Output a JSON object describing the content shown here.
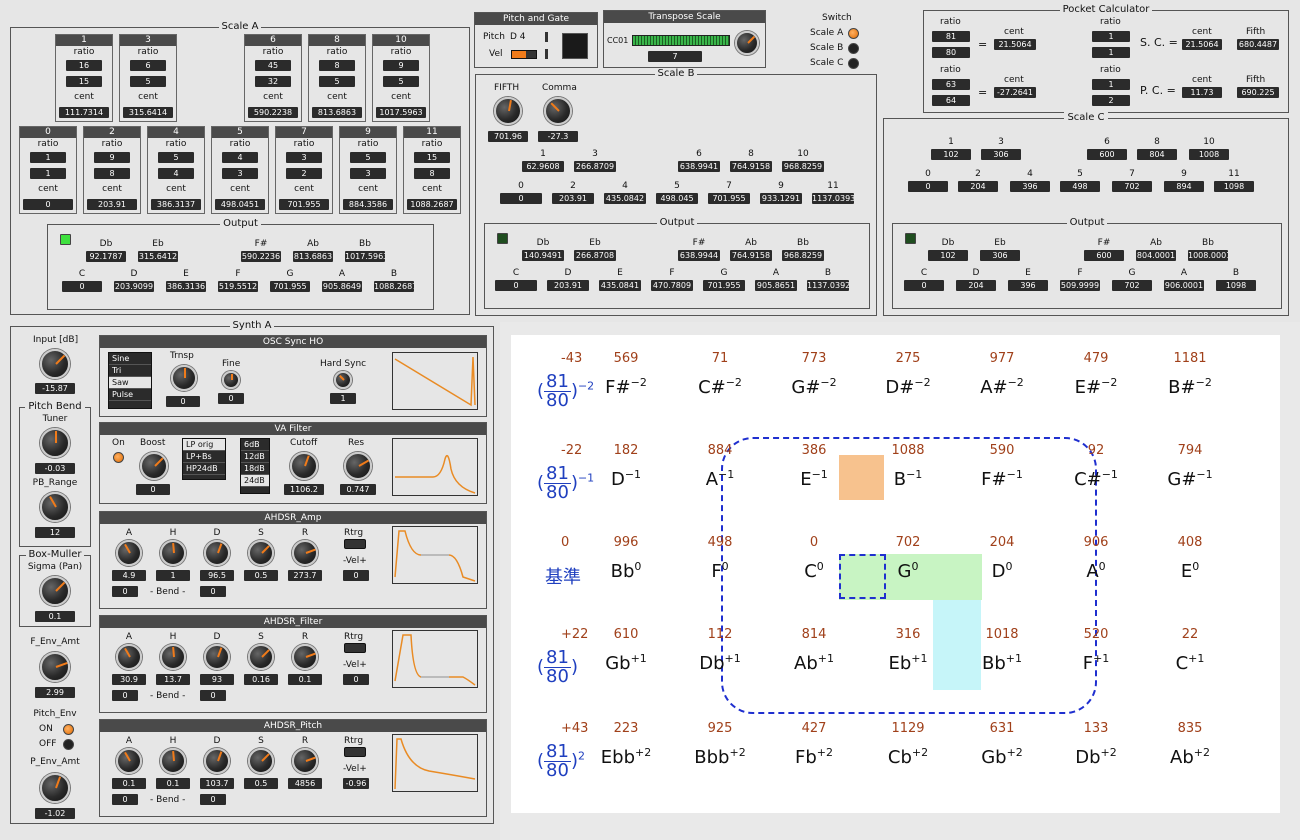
{
  "scaleA": {
    "title": "Scale A",
    "top": [
      {
        "n": "1",
        "r1": "16",
        "r2": "15",
        "c": "111.7314"
      },
      {
        "n": "3",
        "r1": "6",
        "r2": "5",
        "c": "315.6414"
      },
      {
        "n": "6",
        "r1": "45",
        "r2": "32",
        "c": "590.2238"
      },
      {
        "n": "8",
        "r1": "8",
        "r2": "5",
        "c": "813.6863"
      },
      {
        "n": "10",
        "r1": "9",
        "r2": "5",
        "c": "1017.5963"
      }
    ],
    "bottom": [
      {
        "n": "0",
        "r1": "1",
        "r2": "1",
        "c": "0"
      },
      {
        "n": "2",
        "r1": "9",
        "r2": "8",
        "c": "203.91"
      },
      {
        "n": "4",
        "r1": "5",
        "r2": "4",
        "c": "386.3137"
      },
      {
        "n": "5",
        "r1": "4",
        "r2": "3",
        "c": "498.0451"
      },
      {
        "n": "7",
        "r1": "3",
        "r2": "2",
        "c": "701.955"
      },
      {
        "n": "9",
        "r1": "5",
        "r2": "3",
        "c": "884.3586"
      },
      {
        "n": "11",
        "r1": "15",
        "r2": "8",
        "c": "1088.2687"
      }
    ],
    "ratio": "ratio",
    "cent": "cent",
    "output": {
      "title": "Output",
      "sharps": [
        {
          "k": "Db",
          "v": "92.1787"
        },
        {
          "k": "Eb",
          "v": "315.6412"
        },
        {
          "k": "F#",
          "v": "590.2236"
        },
        {
          "k": "Ab",
          "v": "813.6863"
        },
        {
          "k": "Bb",
          "v": "1017.5963"
        }
      ],
      "naturals": [
        {
          "k": "C",
          "v": "0"
        },
        {
          "k": "D",
          "v": "203.9099"
        },
        {
          "k": "E",
          "v": "386.3136"
        },
        {
          "k": "F",
          "v": "519.5512"
        },
        {
          "k": "G",
          "v": "701.955"
        },
        {
          "k": "A",
          "v": "905.8649"
        },
        {
          "k": "B",
          "v": "1088.2687"
        }
      ]
    }
  },
  "pitchGate": {
    "title": "Pitch and Gate",
    "pitch_label": "Pitch",
    "pitch_value": "D  4",
    "vel_label": "Vel"
  },
  "transpose": {
    "title": "Transpose Scale",
    "cc": "CC01",
    "value": "7"
  },
  "switch": {
    "title": "Switch",
    "items": [
      "Scale A",
      "Scale B",
      "Scale C"
    ]
  },
  "pocket": {
    "title": "Pocket Calculator",
    "ratio": "ratio",
    "cent": "cent",
    "fifth": "Fifth",
    "r1": {
      "a": "81",
      "b": "80",
      "cent": "21.5064"
    },
    "r2": {
      "a": "63",
      "b": "64",
      "cent": "-27.2641"
    },
    "sc": {
      "label": "S. C. =",
      "a": "1",
      "b": "1",
      "cent": "21.5064",
      "fifth": "680.4487"
    },
    "pc": {
      "label": "P. C. =",
      "a": "1",
      "b": "2",
      "cent": "11.73",
      "fifth": "690.225"
    },
    "eq": "="
  },
  "scaleB": {
    "title": "Scale B",
    "fifth_label": "FIFTH",
    "fifth_value": "701.96",
    "comma_label": "Comma",
    "comma_value": "-27.3",
    "top": [
      {
        "n": "1",
        "c": "62.9608"
      },
      {
        "n": "3",
        "c": "266.8709"
      },
      {
        "n": "6",
        "c": "638.9941"
      },
      {
        "n": "8",
        "c": "764.9158"
      },
      {
        "n": "10",
        "c": "968.8259"
      }
    ],
    "bottom": [
      {
        "n": "0",
        "c": "0"
      },
      {
        "n": "2",
        "c": "203.91"
      },
      {
        "n": "4",
        "c": "435.0842"
      },
      {
        "n": "5",
        "c": "498.045"
      },
      {
        "n": "7",
        "c": "701.955"
      },
      {
        "n": "9",
        "c": "933.1291"
      },
      {
        "n": "11",
        "c": "1137.0393"
      }
    ],
    "output": {
      "title": "Output",
      "sharps": [
        {
          "k": "Db",
          "v": "140.9491"
        },
        {
          "k": "Eb",
          "v": "266.8708"
        },
        {
          "k": "F#",
          "v": "638.9944"
        },
        {
          "k": "Ab",
          "v": "764.9158"
        },
        {
          "k": "Bb",
          "v": "968.8259"
        }
      ],
      "naturals": [
        {
          "k": "C",
          "v": "0"
        },
        {
          "k": "D",
          "v": "203.91"
        },
        {
          "k": "E",
          "v": "435.0841"
        },
        {
          "k": "F",
          "v": "470.7809"
        },
        {
          "k": "G",
          "v": "701.955"
        },
        {
          "k": "A",
          "v": "905.8651"
        },
        {
          "k": "B",
          "v": "1137.0392"
        }
      ]
    }
  },
  "scaleC": {
    "title": "Scale C",
    "top": [
      {
        "n": "1",
        "c": "102"
      },
      {
        "n": "3",
        "c": "306"
      },
      {
        "n": "6",
        "c": "600"
      },
      {
        "n": "8",
        "c": "804"
      },
      {
        "n": "10",
        "c": "1008"
      }
    ],
    "bottom": [
      {
        "n": "0",
        "c": "0"
      },
      {
        "n": "2",
        "c": "204"
      },
      {
        "n": "4",
        "c": "396"
      },
      {
        "n": "5",
        "c": "498"
      },
      {
        "n": "7",
        "c": "702"
      },
      {
        "n": "9",
        "c": "894"
      },
      {
        "n": "11",
        "c": "1098"
      }
    ],
    "output": {
      "title": "Output",
      "sharps": [
        {
          "k": "Db",
          "v": "102"
        },
        {
          "k": "Eb",
          "v": "306"
        },
        {
          "k": "F#",
          "v": "600"
        },
        {
          "k": "Ab",
          "v": "804.0001"
        },
        {
          "k": "Bb",
          "v": "1008.0001"
        }
      ],
      "naturals": [
        {
          "k": "C",
          "v": "0"
        },
        {
          "k": "D",
          "v": "204"
        },
        {
          "k": "E",
          "v": "396"
        },
        {
          "k": "F",
          "v": "509.9999"
        },
        {
          "k": "G",
          "v": "702"
        },
        {
          "k": "A",
          "v": "906.0001"
        },
        {
          "k": "B",
          "v": "1098"
        }
      ]
    }
  },
  "synth": {
    "title": "Synth A",
    "input_label": "Input [dB]",
    "input_value": "-15.87",
    "pitchbend": {
      "title": "Pitch Bend",
      "tuner": "Tuner",
      "tuner_value": "-0.03",
      "pbrange": "PB_Range",
      "pbrange_value": "12"
    },
    "boxmuller": {
      "title": "Box-Muller",
      "sigma": "Sigma (Pan)",
      "sigma_value": "0.1"
    },
    "fenv": {
      "label": "F_Env_Amt",
      "value": "2.99"
    },
    "pitchenv": {
      "label": "Pitch_Env",
      "on": "ON",
      "off": "OFF"
    },
    "penv": {
      "label": "P_Env_Amt",
      "value": "-1.02"
    },
    "osc": {
      "title": "OSC Sync HO",
      "waves": [
        "Sine",
        "Tri",
        "Saw",
        "Pulse"
      ],
      "trnsp": "Trnsp",
      "trnsp_value": "0",
      "fine": "Fine",
      "fine_value": "0",
      "hardsync": "Hard Sync",
      "hardsync_value": "1"
    },
    "filter": {
      "title": "VA Filter",
      "on": "On",
      "boost": "Boost",
      "boost_value": "0",
      "types": [
        "LP orig",
        "LP+Bs",
        "HP24dB"
      ],
      "slopes": [
        "6dB",
        "12dB",
        "18dB",
        "24dB"
      ],
      "cutoff": "Cutoff",
      "cutoff_value": "1106.2",
      "res": "Res",
      "res_value": "0.747"
    },
    "envs": [
      {
        "title": "AHDSR_Amp",
        "vals": [
          "4.9",
          "1",
          "96.5",
          "0.5",
          "273.7"
        ],
        "bend": [
          "0",
          "0"
        ],
        "vel": "0"
      },
      {
        "title": "AHDSR_Filter",
        "vals": [
          "30.9",
          "13.7",
          "93",
          "0.16",
          "0.1"
        ],
        "bend": [
          "0",
          "0"
        ],
        "vel": "0"
      },
      {
        "title": "AHDSR_Pitch",
        "vals": [
          "0.1",
          "0.1",
          "103.7",
          "0.5",
          "4856"
        ],
        "bend": [
          "0",
          "0"
        ],
        "vel": "-0.96"
      }
    ],
    "env_labels": [
      "A",
      "H",
      "D",
      "S",
      "R"
    ],
    "rtrg": "Rtrg",
    "vel_label": "-Vel+",
    "bend_label": "- Bend -"
  },
  "table": {
    "rowlabels": [
      {
        "v": "-43",
        "a": "81",
        "b": "80",
        "exp": "−2"
      },
      {
        "v": "-22",
        "a": "81",
        "b": "80",
        "exp": "−1"
      },
      {
        "v": "0",
        "text": "基準"
      },
      {
        "v": "+22",
        "a": "81",
        "b": "80",
        "exp": ""
      },
      {
        "v": "+43",
        "a": "81",
        "b": "80",
        "exp": "2"
      }
    ],
    "rows": [
      [
        [
          "569",
          "F#",
          "−2"
        ],
        [
          "71",
          "C#",
          "−2"
        ],
        [
          "773",
          "G#",
          "−2"
        ],
        [
          "275",
          "D#",
          "−2"
        ],
        [
          "977",
          "A#",
          "−2"
        ],
        [
          "479",
          "E#",
          "−2"
        ],
        [
          "1181",
          "B#",
          "−2"
        ]
      ],
      [
        [
          "182",
          "D",
          "−1"
        ],
        [
          "884",
          "A",
          "−1"
        ],
        [
          "386",
          "E",
          "−1"
        ],
        [
          "1088",
          "B",
          "−1"
        ],
        [
          "590",
          "F#",
          "−1"
        ],
        [
          "92",
          "C#",
          "−1"
        ],
        [
          "794",
          "G#",
          "−1"
        ]
      ],
      [
        [
          "996",
          "Bb",
          "0"
        ],
        [
          "498",
          "F",
          "0"
        ],
        [
          "0",
          "C",
          "0"
        ],
        [
          "702",
          "G",
          "0"
        ],
        [
          "204",
          "D",
          "0"
        ],
        [
          "906",
          "A",
          "0"
        ],
        [
          "408",
          "E",
          "0"
        ]
      ],
      [
        [
          "610",
          "Gb",
          "+1"
        ],
        [
          "112",
          "Db",
          "+1"
        ],
        [
          "814",
          "Ab",
          "+1"
        ],
        [
          "316",
          "Eb",
          "+1"
        ],
        [
          "1018",
          "Bb",
          "+1"
        ],
        [
          "520",
          "F",
          "+1"
        ],
        [
          "22",
          "C",
          "+1"
        ]
      ],
      [
        [
          "223",
          "Ebb",
          "+2"
        ],
        [
          "925",
          "Bbb",
          "+2"
        ],
        [
          "427",
          "Fb",
          "+2"
        ],
        [
          "1129",
          "Cb",
          "+2"
        ],
        [
          "631",
          "Gb",
          "+2"
        ],
        [
          "133",
          "Db",
          "+2"
        ],
        [
          "835",
          "Ab",
          "+2"
        ]
      ]
    ]
  }
}
